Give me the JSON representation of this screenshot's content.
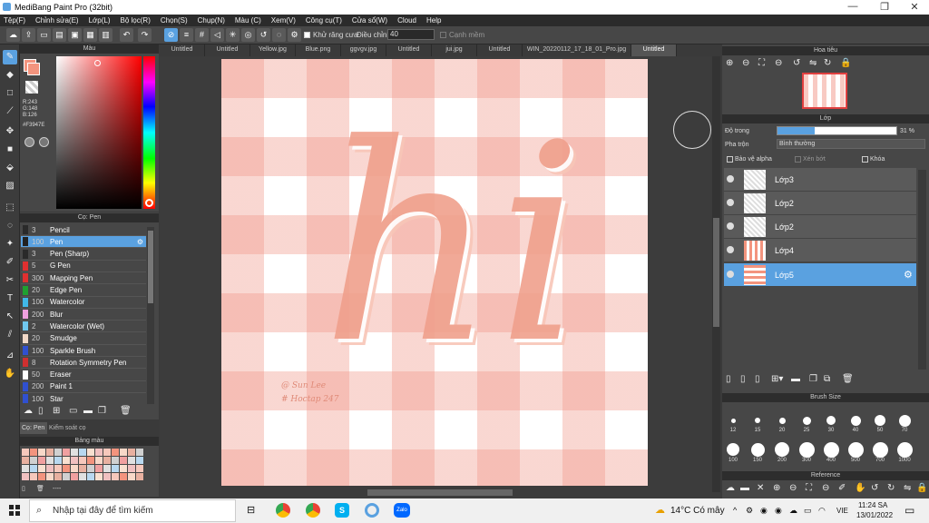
{
  "window": {
    "title": "MediBang Paint Pro (32bit)",
    "min": "—",
    "max": "❐",
    "close": "✕"
  },
  "menu": [
    "Tệp(F)",
    "Chỉnh sửa(E)",
    "Lớp(L)",
    "Bộ lọc(R)",
    "Chọn(S)",
    "Chụp(N)",
    "Màu (C)",
    "Xem(V)",
    "Công cụ(T)",
    "Cửa sổ(W)",
    "Cloud",
    "Help"
  ],
  "toolbar": {
    "antialias_label": "Khử răng cưa",
    "adjust_label": "Điều chỉnh",
    "adjust_value": "40",
    "smooth_label": "Cạnh mềm"
  },
  "color_panel": {
    "title": "Màu",
    "r": "R:243",
    "g": "G:148",
    "b": "B:126",
    "hex": "#F3947E",
    "fg_color": "#F3947E"
  },
  "brush_panel": {
    "title": "Cọ: Pen",
    "tab_brush": "Cọ: Pen",
    "tab_control": "Kiểm soát cọ",
    "items": [
      {
        "size": "3",
        "name": "Pencil",
        "color": "#2a2a2a"
      },
      {
        "size": "100",
        "name": "Pen",
        "color": "#222222"
      },
      {
        "size": "3",
        "name": "Pen (Sharp)",
        "color": "#2a2a2a"
      },
      {
        "size": "5",
        "name": "G Pen",
        "color": "#e03030"
      },
      {
        "size": "300",
        "name": "Mapping Pen",
        "color": "#e03030"
      },
      {
        "size": "20",
        "name": "Edge Pen",
        "color": "#20a030"
      },
      {
        "size": "100",
        "name": "Watercolor",
        "color": "#40b8e8"
      },
      {
        "size": "200",
        "name": "Blur",
        "color": "#f0a0e0"
      },
      {
        "size": "2",
        "name": "Watercolor (Wet)",
        "color": "#70c8f0"
      },
      {
        "size": "20",
        "name": "Smudge",
        "color": "#f0d8c8"
      },
      {
        "size": "100",
        "name": "Sparkle Brush",
        "color": "#3050d0"
      },
      {
        "size": "8",
        "name": "Rotation Symmetry Pen",
        "color": "#d03030"
      },
      {
        "size": "50",
        "name": "Eraser",
        "color": "#ffffff"
      },
      {
        "size": "200",
        "name": "Paint 1",
        "color": "#3050d0"
      },
      {
        "size": "100",
        "name": "Star",
        "color": "#3050d0"
      }
    ]
  },
  "palette_panel": {
    "title": "Bảng màu",
    "footer": "----"
  },
  "tabs": [
    "Untitled",
    "Untitled",
    "Yellow.jpg",
    "Blue.png",
    "ggvgv.jpg",
    "Untitled",
    "jui.jpg",
    "Untitled",
    "WIN_20220112_17_18_01_Pro.jpg",
    "Untitled"
  ],
  "artwork": {
    "main_text": "hi",
    "signature_line1": "@ Sun Lee",
    "signature_line2": "# Hoctap 247"
  },
  "navigator": {
    "title": "Hoa tiêu"
  },
  "layer_panel": {
    "title": "Lớp",
    "opacity_label": "Độ trong",
    "opacity_value": "31 %",
    "opacity_fraction": 0.31,
    "blend_label": "Pha trộn",
    "blend_value": "Bình thường",
    "alpha_protect": "Bảo vệ alpha",
    "clip": "Xén bớt",
    "lock": "Khóa",
    "layers": [
      {
        "name": "Lớp3"
      },
      {
        "name": "Lớp2"
      },
      {
        "name": "Lớp2"
      },
      {
        "name": "Lớp4"
      },
      {
        "name": "Lớp5"
      }
    ]
  },
  "brush_size": {
    "title": "Brush Size",
    "row1": [
      "12",
      "15",
      "20",
      "25",
      "30",
      "40",
      "50",
      "70"
    ],
    "row2": [
      "100",
      "150",
      "200",
      "300",
      "400",
      "500",
      "700",
      "1000"
    ]
  },
  "reference": {
    "title": "Reference"
  },
  "taskbar": {
    "search_placeholder": "Nhập tại đây để tìm kiếm",
    "weather": "14°C  Có mây",
    "lang": "VIE",
    "time": "11:24 SA",
    "date": "13/01/2022"
  }
}
